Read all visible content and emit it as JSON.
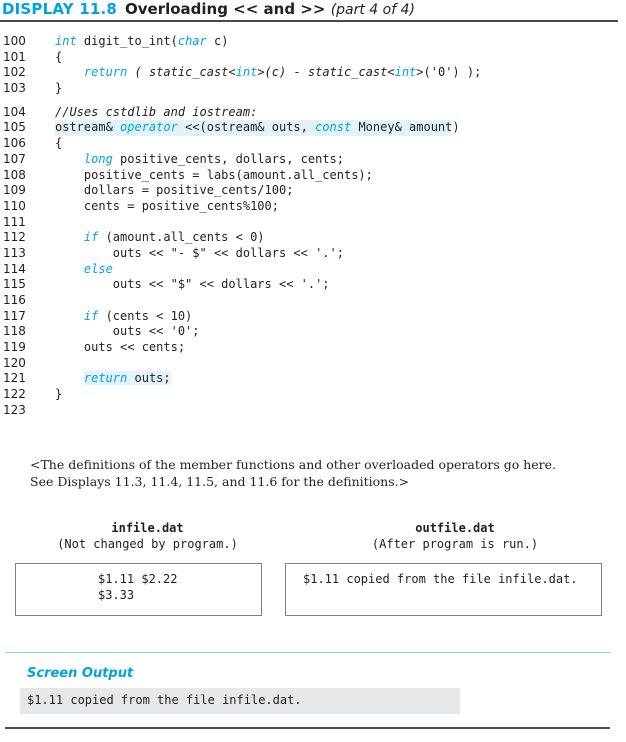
{
  "header": {
    "display_label": "DISPLAY 11.8",
    "title": "Overloading << and >>",
    "part": "(part 4 of 4)"
  },
  "code": {
    "lines": [
      {
        "num": "100",
        "segments": [
          {
            "t": "int",
            "k": "kw"
          },
          {
            "t": " digit_to_int("
          },
          {
            "t": "char",
            "k": "kw"
          },
          {
            "t": " c)"
          }
        ]
      },
      {
        "num": "101",
        "segments": [
          {
            "t": "{"
          }
        ]
      },
      {
        "num": "102",
        "segments": [
          {
            "t": "    "
          },
          {
            "t": "return",
            "k": "kw"
          },
          {
            "t": " ( static_cast<",
            "k": "it"
          },
          {
            "t": "int",
            "k": "kw"
          },
          {
            "t": ">(c) - static_cast<",
            "k": "it"
          },
          {
            "t": "int",
            "k": "kw"
          },
          {
            "t": ">('0') );"
          }
        ]
      },
      {
        "num": "103",
        "segments": [
          {
            "t": "}"
          }
        ]
      },
      {
        "num": "104",
        "gap_before": true,
        "segments": [
          {
            "t": "//Uses cstdlib and iostream:",
            "k": "cm"
          }
        ]
      },
      {
        "num": "105",
        "highlight": "full",
        "segments": [
          {
            "t": "ostream& "
          },
          {
            "t": "operator",
            "k": "kw"
          },
          {
            "t": " <<(ostream& outs, "
          },
          {
            "t": "const",
            "k": "kw"
          },
          {
            "t": " Money& amount)"
          }
        ]
      },
      {
        "num": "106",
        "segments": [
          {
            "t": "{"
          }
        ]
      },
      {
        "num": "107",
        "segments": [
          {
            "t": "    "
          },
          {
            "t": "long",
            "k": "kw"
          },
          {
            "t": " positive_cents, dollars, cents;"
          }
        ]
      },
      {
        "num": "108",
        "segments": [
          {
            "t": "    positive_cents = labs(amount.all_cents);"
          }
        ]
      },
      {
        "num": "109",
        "segments": [
          {
            "t": "    dollars = positive_cents/100;"
          }
        ]
      },
      {
        "num": "110",
        "segments": [
          {
            "t": "    cents = positive_cents%100;"
          }
        ]
      },
      {
        "num": "111",
        "segments": []
      },
      {
        "num": "112",
        "segments": [
          {
            "t": "    "
          },
          {
            "t": "if",
            "k": "kw"
          },
          {
            "t": " (amount.all_cents < 0)"
          }
        ]
      },
      {
        "num": "113",
        "segments": [
          {
            "t": "        outs << \"- $\" << dollars << '.';"
          }
        ]
      },
      {
        "num": "114",
        "segments": [
          {
            "t": "    "
          },
          {
            "t": "else",
            "k": "kw"
          }
        ]
      },
      {
        "num": "115",
        "segments": [
          {
            "t": "        outs << \"$\" << dollars << '.';"
          }
        ]
      },
      {
        "num": "116",
        "segments": []
      },
      {
        "num": "117",
        "segments": [
          {
            "t": "    "
          },
          {
            "t": "if",
            "k": "kw"
          },
          {
            "t": " (cents < 10)"
          }
        ]
      },
      {
        "num": "118",
        "segments": [
          {
            "t": "        outs << '0';"
          }
        ]
      },
      {
        "num": "119",
        "segments": [
          {
            "t": "    outs << cents;"
          }
        ]
      },
      {
        "num": "120",
        "segments": []
      },
      {
        "num": "121",
        "highlight": "partial",
        "segments": [
          {
            "t": "    "
          },
          {
            "t": "return",
            "k": "kw",
            "hl": true
          },
          {
            "t": " outs;",
            "hl": true
          }
        ]
      },
      {
        "num": "122",
        "segments": [
          {
            "t": "}"
          }
        ]
      },
      {
        "num": "123",
        "segments": []
      }
    ]
  },
  "note": {
    "line1": "<The definitions of the member functions and other overloaded operators go here.",
    "line2": "See Displays 11.3, 11.4, 11.5, and 11.6 for the definitions.>"
  },
  "files": {
    "infile": {
      "name": "infile.dat",
      "desc": "(Not changed by program.)",
      "content_line1": "$1.11 $2.22",
      "content_line2": "$3.33"
    },
    "outfile": {
      "name": "outfile.dat",
      "desc": "(After program is run.)",
      "content_line1": "$1.11 copied from the file infile.dat."
    }
  },
  "screen_output": {
    "title": "Screen Output",
    "text": "$1.11 copied from the file infile.dat."
  },
  "colors": {
    "accent": "#00a3e0",
    "highlight": "#e3f3fb",
    "output_bg": "#e6e7e8"
  }
}
